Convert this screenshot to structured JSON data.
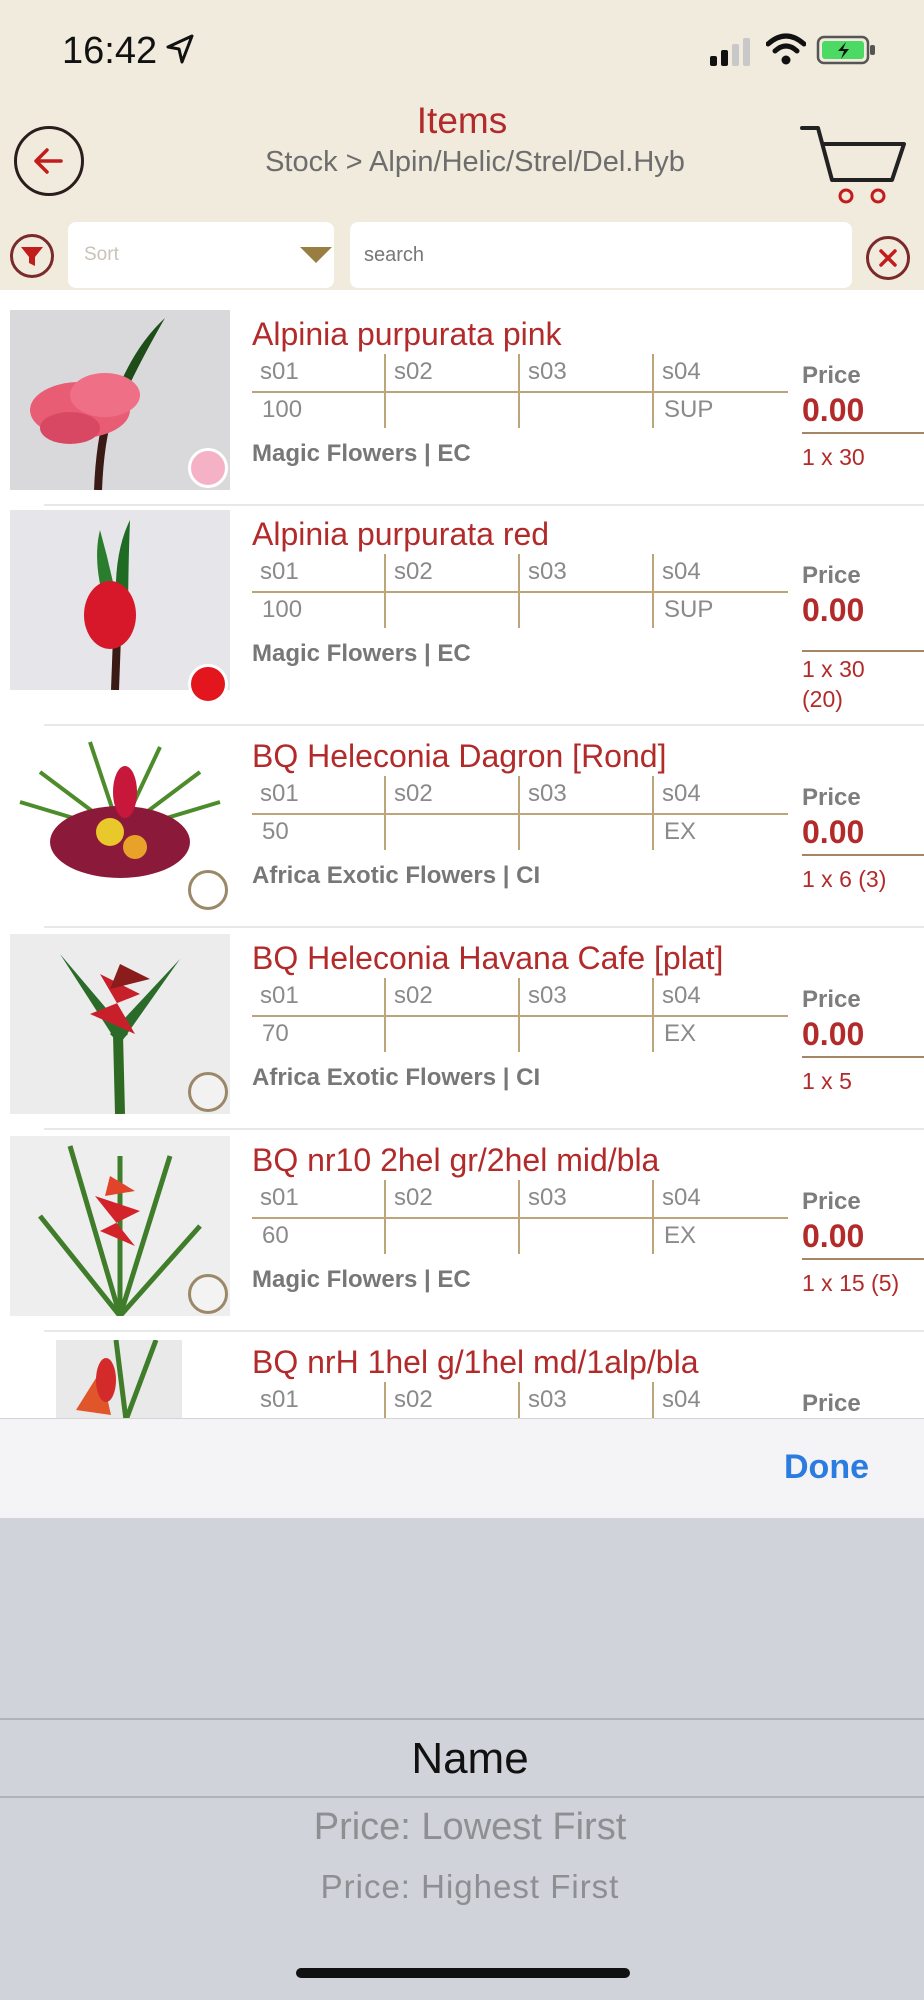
{
  "status_bar": {
    "time": "16:42"
  },
  "header": {
    "title": "Items",
    "breadcrumb": "Stock > Alpin/Helic/Strel/Del.Hyb"
  },
  "toolbar": {
    "sort_placeholder": "Sort",
    "search_placeholder": "search"
  },
  "columns": [
    "s01",
    "s02",
    "s03",
    "s04"
  ],
  "price_label": "Price",
  "items": [
    {
      "name": "Alpinia purpurata pink",
      "s01": "100",
      "s04": "SUP",
      "supplier": "Magic Flowers | EC",
      "price": "0.00",
      "qty": "1 x 30",
      "radio_color": "#f5b2c6"
    },
    {
      "name": "Alpinia purpurata red",
      "s01": "100",
      "s04": "SUP",
      "supplier": "Magic Flowers | EC",
      "price": "0.00",
      "qty": "1 x 30\n(20)",
      "radio_color": "#e3161e"
    },
    {
      "name": "BQ Heleconia Dagron [Rond]",
      "s01": "50",
      "s04": "EX",
      "supplier": "Africa Exotic Flowers | CI",
      "price": "0.00",
      "qty": "1 x 6 (3)",
      "radio_color": ""
    },
    {
      "name": "BQ Heleconia Havana Cafe [plat]",
      "s01": "70",
      "s04": "EX",
      "supplier": "Africa Exotic Flowers | CI",
      "price": "0.00",
      "qty": "1 x 5",
      "radio_color": ""
    },
    {
      "name": "BQ nr10 2hel gr/2hel mid/bla",
      "s01": "60",
      "s04": "EX",
      "supplier": "Magic Flowers | EC",
      "price": "0.00",
      "qty": "1 x 15 (5)",
      "radio_color": ""
    },
    {
      "name": "BQ nrH 1hel g/1hel md/1alp/bla",
      "s01": "",
      "s04": "",
      "supplier": "",
      "price": "",
      "qty": "",
      "radio_color": ""
    }
  ],
  "accessory": {
    "done_label": "Done"
  },
  "picker": {
    "options": [
      "Name",
      "Price: Lowest First",
      "Price: Highest First"
    ],
    "selected": "Name"
  },
  "colors": {
    "accent": "#b22a2a",
    "header_bg": "#f1ebdd",
    "done": "#2a7ce0"
  }
}
